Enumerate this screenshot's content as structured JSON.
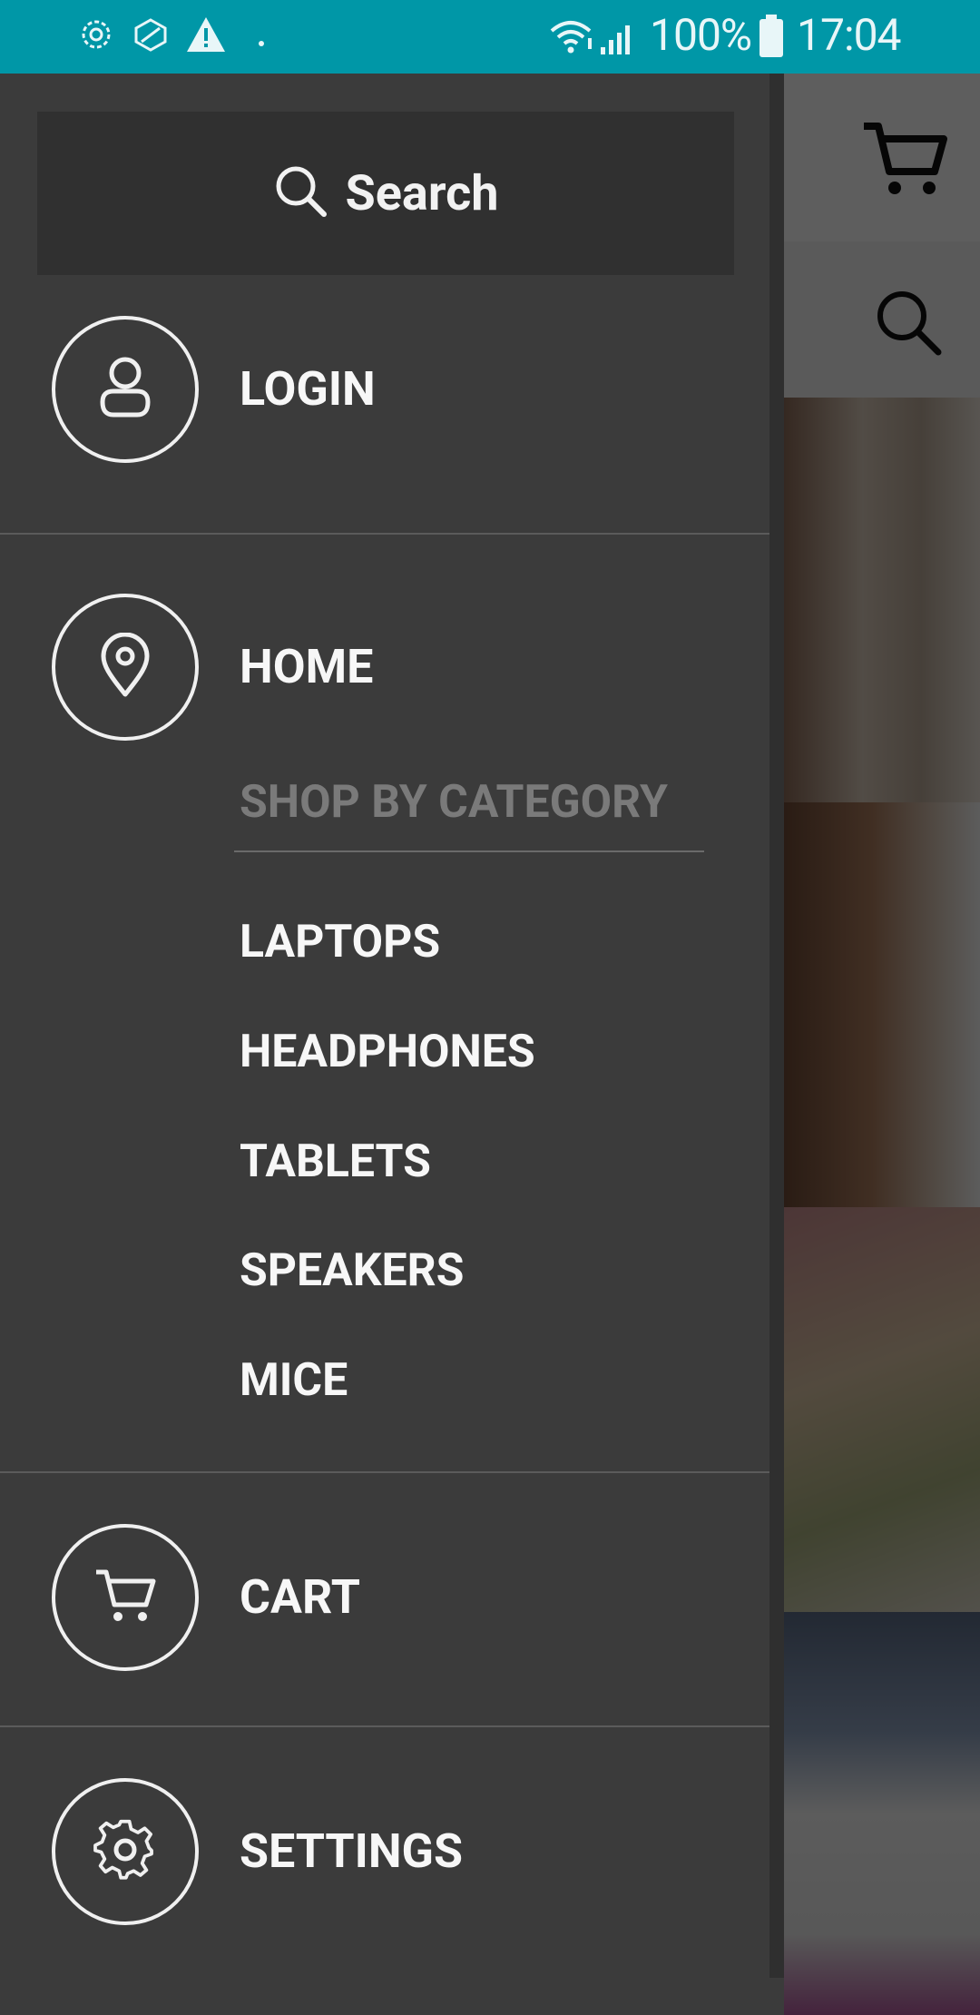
{
  "status_bar": {
    "battery": "100%",
    "time": "17:04",
    "icons": [
      "settings-gear-icon",
      "box-icon",
      "warning-icon",
      "dot-icon",
      "wifi-icon",
      "signal-icon",
      "battery-icon"
    ]
  },
  "drawer": {
    "search": {
      "label": "Search",
      "icon": "search-icon"
    },
    "login": {
      "label": "LOGIN",
      "icon": "user-icon"
    },
    "home": {
      "label": "HOME",
      "icon": "location-pin-icon"
    },
    "category_header": "SHOP BY CATEGORY",
    "categories": [
      "LAPTOPS",
      "HEADPHONES",
      "TABLETS",
      "SPEAKERS",
      "MICE"
    ],
    "cart": {
      "label": "CART",
      "icon": "cart-icon"
    },
    "settings": {
      "label": "SETTINGS",
      "icon": "gear-icon"
    }
  },
  "background_app": {
    "header_icon": "cart-icon",
    "search_icon": "search-icon"
  },
  "colors": {
    "status_bar": "#0097a7",
    "drawer_bg": "#3b3b3b",
    "search_bg": "#303030",
    "category_header": "#7a7a7a"
  }
}
